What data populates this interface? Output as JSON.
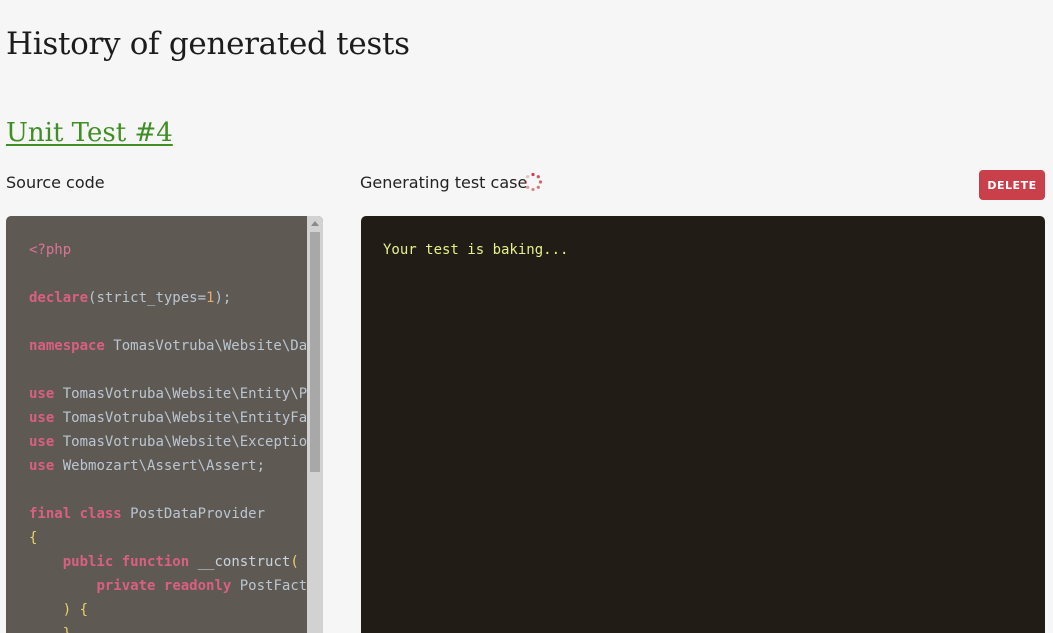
{
  "page": {
    "title": "History of generated tests"
  },
  "test": {
    "link_label": "Unit Test #4",
    "source_label": "Source code",
    "status_label": "Generating test case",
    "delete_label": "DELETE",
    "output_text": "Your test is baking..."
  },
  "code_lines": [
    [
      {
        "t": "<?php",
        "c": "tag"
      }
    ],
    [],
    [
      {
        "t": "declare",
        "c": "kw"
      },
      {
        "t": "(strict_types=",
        "c": ""
      },
      {
        "t": "1",
        "c": "num"
      },
      {
        "t": ");",
        "c": ""
      }
    ],
    [],
    [
      {
        "t": "namespace",
        "c": "kw"
      },
      {
        "t": " TomasVotruba\\Website\\DataProvider;",
        "c": ""
      }
    ],
    [],
    [
      {
        "t": "use",
        "c": "kw"
      },
      {
        "t": " TomasVotruba\\Website\\Entity\\Post;",
        "c": ""
      }
    ],
    [
      {
        "t": "use",
        "c": "kw"
      },
      {
        "t": " TomasVotruba\\Website\\EntityFactory\\PostFactory;",
        "c": ""
      }
    ],
    [
      {
        "t": "use",
        "c": "kw"
      },
      {
        "t": " TomasVotruba\\Website\\Exception\\ShouldNotHappenException;",
        "c": ""
      }
    ],
    [
      {
        "t": "use",
        "c": "kw"
      },
      {
        "t": " Webmozart\\Assert\\Assert;",
        "c": ""
      }
    ],
    [],
    [
      {
        "t": "final",
        "c": "kw"
      },
      {
        "t": " ",
        "c": ""
      },
      {
        "t": "class",
        "c": "kw"
      },
      {
        "t": " PostDataProvider",
        "c": ""
      }
    ],
    [
      {
        "t": "{",
        "c": "punc"
      }
    ],
    [
      {
        "t": "    ",
        "c": ""
      },
      {
        "t": "public",
        "c": "kw"
      },
      {
        "t": " ",
        "c": ""
      },
      {
        "t": "function",
        "c": "kw"
      },
      {
        "t": " __construct",
        "c": "fn"
      },
      {
        "t": "(",
        "c": "punc"
      }
    ],
    [
      {
        "t": "        ",
        "c": ""
      },
      {
        "t": "private",
        "c": "kw"
      },
      {
        "t": " ",
        "c": ""
      },
      {
        "t": "readonly",
        "c": "kw"
      },
      {
        "t": " PostFactory $postFactory",
        "c": ""
      }
    ],
    [
      {
        "t": "    ",
        "c": ""
      },
      {
        "t": ") {",
        "c": "punc"
      }
    ],
    [
      {
        "t": "    ",
        "c": ""
      },
      {
        "t": "}",
        "c": "punc"
      }
    ]
  ],
  "colors": {
    "accent_link": "#3f8f24",
    "delete_button": "#c9404b",
    "code_background": "#5f5953",
    "output_background": "#221c16",
    "output_text": "#e5f28a",
    "spinner": "#c9404b"
  },
  "icons": {
    "spinner": "loading-spinner-icon",
    "scroll_up": "scroll-up-arrow-icon"
  }
}
